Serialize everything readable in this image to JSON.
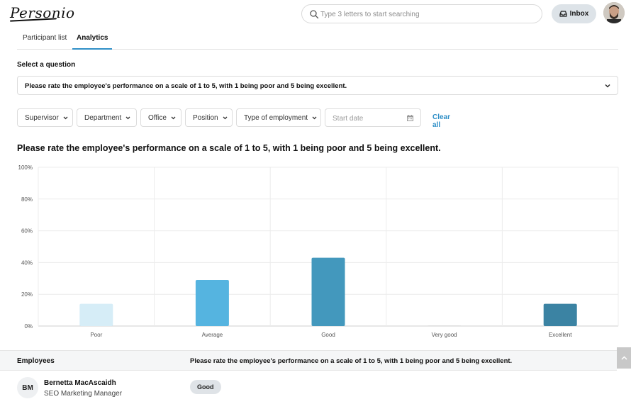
{
  "header": {
    "logo_text": "Personio",
    "search": {
      "placeholder": "Type 3 letters to start searching",
      "value": ""
    },
    "inbox_label": "Inbox"
  },
  "tabs": [
    {
      "label": "Participant list",
      "active": false
    },
    {
      "label": "Analytics",
      "active": true
    }
  ],
  "question_select": {
    "label": "Select a question",
    "value": "Please rate the employee's performance on a scale of 1 to 5, with 1 being poor and 5 being excellent."
  },
  "filters": {
    "items": [
      "Supervisor",
      "Department",
      "Office",
      "Position",
      "Type of employment"
    ],
    "start_date_placeholder": "Start date",
    "clear_all_label": "Clear all"
  },
  "chart_title": "Please rate the employee's performance on a scale of 1 to 5, with 1 being poor and 5 being excellent.",
  "chart_data": {
    "type": "bar",
    "categories": [
      "Poor",
      "Average",
      "Good",
      "Very good",
      "Excellent"
    ],
    "values": [
      14,
      29,
      43,
      0,
      14
    ],
    "colors": [
      "#d6edf7",
      "#55b4e0",
      "#4398bd",
      "#e0e0e0",
      "#3b83a3"
    ],
    "y_ticks": [
      "0%",
      "20%",
      "40%",
      "60%",
      "80%",
      "100%"
    ],
    "ylim": [
      0,
      100
    ],
    "grid": true,
    "xlabel": "",
    "ylabel": ""
  },
  "employees": {
    "header_col1": "Employees",
    "header_col2": "Please rate the employee's performance on a scale of 1 to 5, with 1 being poor and 5 being excellent.",
    "rows": [
      {
        "initials": "BM",
        "name": "Bernetta MacAscaidh",
        "role": "SEO Marketing Manager",
        "answer": "Good"
      }
    ]
  }
}
